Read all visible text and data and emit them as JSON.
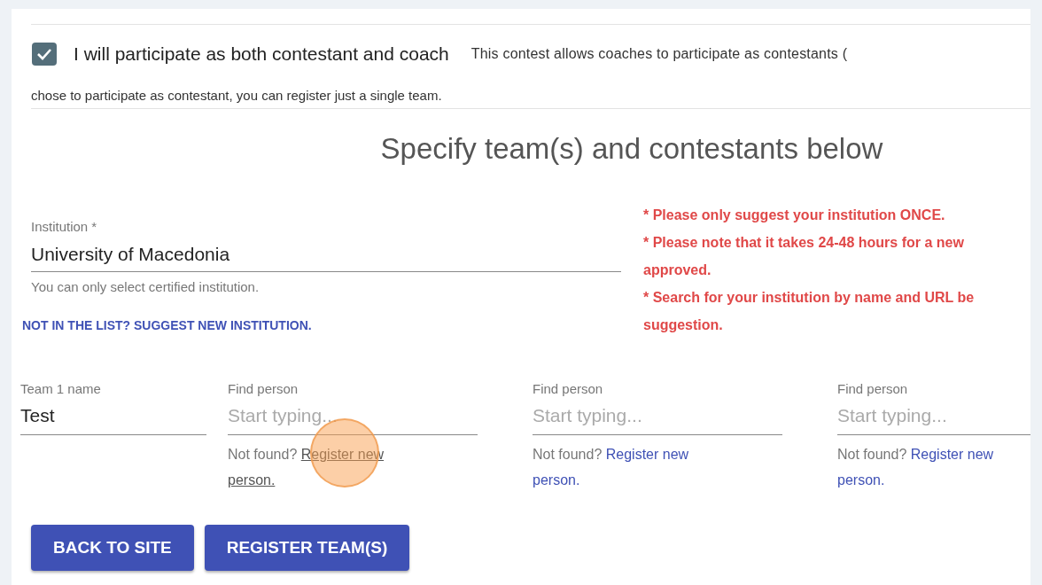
{
  "participation": {
    "checked": true,
    "label": "I will participate as both contestant and coach",
    "description_lines": [
      "This contest allows coaches to participate as contestants (",
      "chose to participate as contestant, you can register just a single team."
    ]
  },
  "heading": "Specify team(s) and contestants below",
  "institution": {
    "label": "Institution *",
    "value": "University of Macedonia",
    "hint": "You can only select certified institution.",
    "suggest_link": "NOT IN THE LIST? SUGGEST NEW INSTITUTION."
  },
  "notes": [
    [
      "* Please only suggest your institution ONCE."
    ],
    [
      "* Please note that it takes 24-48 hours for a new",
      "approved."
    ],
    [
      "* Search for your institution by name and URL be",
      "suggestion."
    ]
  ],
  "team": {
    "label": "Team 1 name",
    "value": "Test"
  },
  "persons": [
    {
      "label": "Find person",
      "placeholder": "Start typing...",
      "prefix": "Not found?",
      "link_lines": [
        "Register new",
        "person."
      ],
      "hovered": true
    },
    {
      "label": "Find person",
      "placeholder": "Start typing...",
      "prefix": "Not found?",
      "link_lines": [
        "Register new",
        "person."
      ],
      "hovered": false
    },
    {
      "label": "Find person",
      "placeholder": "Start typing...",
      "prefix": "Not found?",
      "link_lines": [
        "Register new",
        "person."
      ],
      "hovered": false
    }
  ],
  "buttons": [
    "BACK TO SITE",
    "REGISTER TEAM(S)"
  ]
}
